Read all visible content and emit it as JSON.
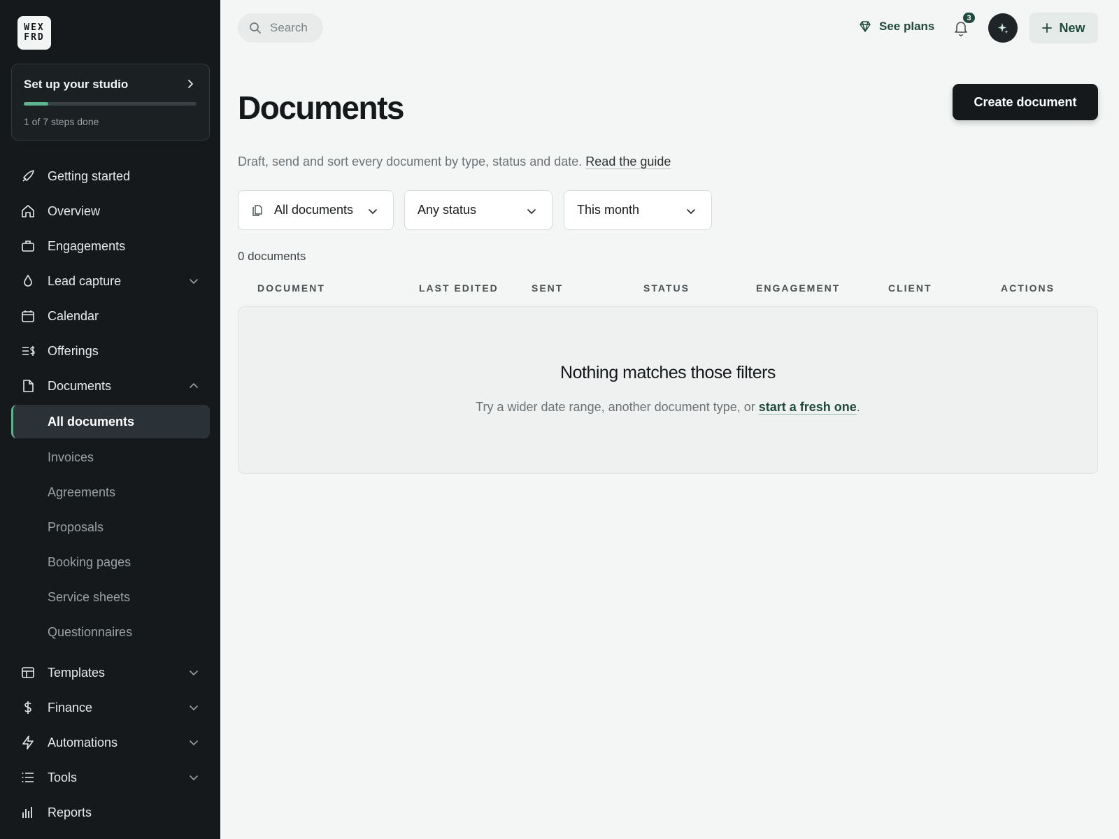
{
  "logo": {
    "line1": "WEX",
    "line2": "FRD"
  },
  "setup": {
    "title": "Set up your studio",
    "steps_text": "1 of 7 steps done",
    "progress": 0.1428
  },
  "nav": {
    "getting_started": "Getting started",
    "overview": "Overview",
    "engagements": "Engagements",
    "lead_capture": "Lead capture",
    "calendar": "Calendar",
    "offerings": "Offerings",
    "documents": "Documents",
    "templates": "Templates",
    "finance": "Finance",
    "automations": "Automations",
    "tools": "Tools",
    "reports": "Reports"
  },
  "documents_sub": [
    "All documents",
    "Invoices",
    "Agreements",
    "Proposals",
    "Booking pages",
    "Service sheets",
    "Questionnaires"
  ],
  "topbar": {
    "search_placeholder": "Search",
    "see_plans": "See plans",
    "notifications": "3",
    "new_label": "New"
  },
  "page": {
    "title": "Documents",
    "create_label": "Create document",
    "subtitle": "Draft, send and sort every document by type, status and date.",
    "guide_link": "Read the guide"
  },
  "filters": {
    "type": "All documents",
    "status": "Any status",
    "date": "This month"
  },
  "count_text": "0 documents",
  "table": {
    "columns": [
      "DOCUMENT",
      "LAST EDITED",
      "SENT",
      "STATUS",
      "ENGAGEMENT",
      "CLIENT",
      "ACTIONS"
    ]
  },
  "empty": {
    "title": "Nothing matches those filters",
    "text": "Try a wider date range, another document type, or",
    "link": "start a fresh one",
    "end": "."
  },
  "colors": {
    "sidebar_bg": "#15191c",
    "accent": "#5fb38f",
    "brand_green": "#1f4a3d",
    "page_bg": "#f4f6f5"
  }
}
